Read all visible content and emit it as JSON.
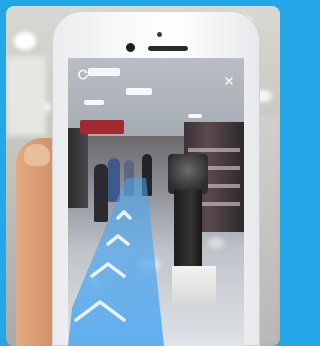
{
  "scene": {
    "background_color": "#23a7e6",
    "ar_path_color": "#4aa6f0"
  },
  "ar_app": {
    "refresh_icon": "refresh-icon",
    "close_icon": "close-icon",
    "navigation": {
      "path_icon": "ar-path-arrows"
    }
  }
}
